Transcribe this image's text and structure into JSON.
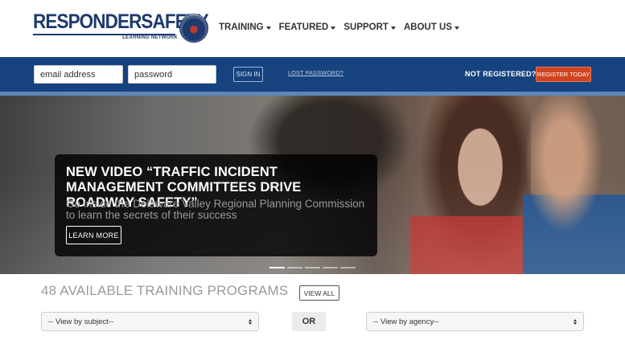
{
  "brand": {
    "logo_text": "RESPONDERSAFETY",
    "logo_subtext": "LEARNING NETWORK"
  },
  "nav": {
    "items": [
      {
        "label": "TRAINING"
      },
      {
        "label": "FEATURED"
      },
      {
        "label": "SUPPORT"
      },
      {
        "label": "ABOUT US"
      }
    ]
  },
  "login": {
    "email_placeholder": "email address",
    "password_placeholder": "password",
    "signin_label": "SIGN IN",
    "lost_password_label": "LOST PASSWORD?",
    "not_registered_label": "NOT REGISTERED?",
    "register_label": "REGISTER TODAY"
  },
  "hero": {
    "title": "NEW VIDEO “TRAFFIC INCIDENT MANAGEMENT COMMITTEES DRIVE ROADWAY SAFETY”",
    "text": "Go inside the Delaware Valley Regional Planning Commission to learn the secrets of their success",
    "button_label": "LEARN MORE",
    "slide_count": 5,
    "active_slide": 1
  },
  "programs": {
    "title": "48 AVAILABLE TRAINING PROGRAMS",
    "view_all_label": "VIEW ALL",
    "subject_select": "-- View by subject--",
    "or_label": "OR",
    "agency_select": "-- View by agency--"
  },
  "colors": {
    "brand_navy": "#1e3a6e",
    "login_bar": "#16427e",
    "register_button": "#d2431f"
  }
}
